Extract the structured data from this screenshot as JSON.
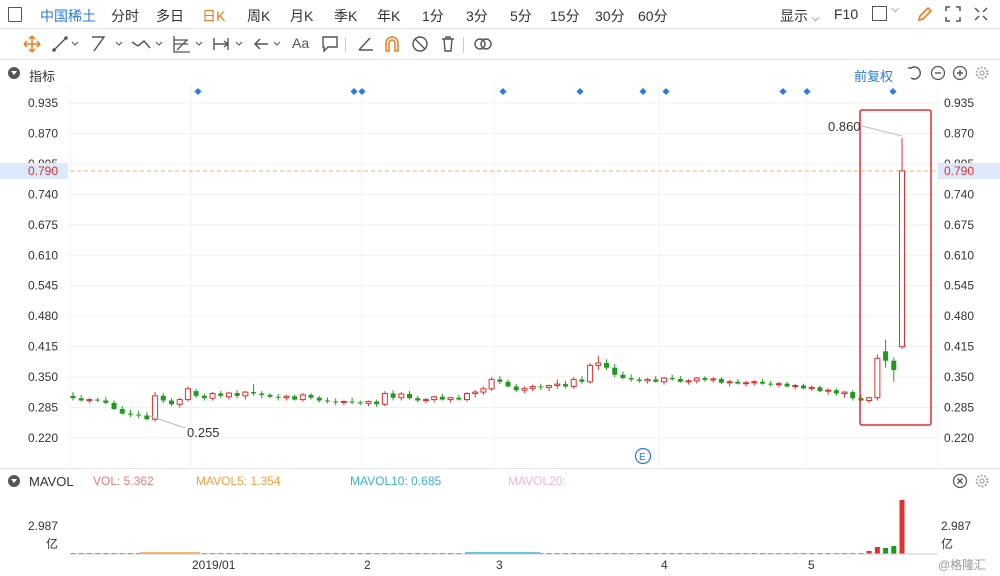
{
  "topbar": {
    "stock_name": "中国稀土",
    "periods": [
      "分时",
      "多日",
      "日K",
      "周K",
      "月K",
      "季K",
      "年K",
      "1分",
      "3分",
      "5分",
      "15分",
      "30分",
      "60分"
    ],
    "active_period": "日K",
    "display_label": "显示",
    "f10_label": "F10"
  },
  "toolbar": {
    "text_tool": "Aa"
  },
  "indicator": {
    "label": "指标",
    "adjust_label": "前复权"
  },
  "price_axis": {
    "ticks": [
      "0.935",
      "0.870",
      "0.805",
      "0.790",
      "0.740",
      "0.675",
      "0.610",
      "0.545",
      "0.480",
      "0.415",
      "0.350",
      "0.285",
      "0.220"
    ],
    "current_price": "0.790",
    "current_color": "#e03030"
  },
  "annotations": {
    "high_label": "0.860",
    "low_label": "0.255",
    "event_marker": "E"
  },
  "x_axis": {
    "labels": [
      "2019/01",
      "2",
      "3",
      "4",
      "5"
    ]
  },
  "volume": {
    "label": "MAVOL",
    "vol": "VOL: 5.362",
    "mavol5": "MAVOL5: 1.354",
    "mavol10": "MAVOL10: 0.685",
    "mavol20": "MAVOL20:",
    "axis_value": "2.987",
    "axis_unit": "亿"
  },
  "colors": {
    "up": "#e03030",
    "down": "#1e9a1e",
    "accent": "#2a7ae2",
    "active": "#f07a15",
    "vol_color": "#e87a7a",
    "mavol5_color": "#f0a040",
    "mavol10_color": "#3cb0d0",
    "mavol20_color": "#e8a0d8"
  },
  "watermark": "@格隆汇",
  "chart_data": {
    "type": "candlestick",
    "ylim": [
      0.22,
      0.935
    ],
    "candles": [
      [
        0.31,
        0.318,
        0.3,
        0.305
      ],
      [
        0.305,
        0.312,
        0.298,
        0.3
      ],
      [
        0.3,
        0.305,
        0.295,
        0.302
      ],
      [
        0.302,
        0.306,
        0.297,
        0.3
      ],
      [
        0.3,
        0.308,
        0.292,
        0.295
      ],
      [
        0.295,
        0.3,
        0.28,
        0.282
      ],
      [
        0.282,
        0.288,
        0.27,
        0.272
      ],
      [
        0.272,
        0.28,
        0.265,
        0.27
      ],
      [
        0.27,
        0.278,
        0.262,
        0.268
      ],
      [
        0.268,
        0.275,
        0.258,
        0.26
      ],
      [
        0.26,
        0.318,
        0.255,
        0.31
      ],
      [
        0.31,
        0.316,
        0.295,
        0.3
      ],
      [
        0.3,
        0.305,
        0.288,
        0.292
      ],
      [
        0.292,
        0.306,
        0.285,
        0.302
      ],
      [
        0.302,
        0.33,
        0.298,
        0.325
      ],
      [
        0.32,
        0.325,
        0.305,
        0.31
      ],
      [
        0.31,
        0.315,
        0.3,
        0.305
      ],
      [
        0.305,
        0.318,
        0.3,
        0.315
      ],
      [
        0.315,
        0.32,
        0.305,
        0.31
      ],
      [
        0.308,
        0.318,
        0.302,
        0.316
      ],
      [
        0.316,
        0.322,
        0.305,
        0.31
      ],
      [
        0.31,
        0.32,
        0.302,
        0.318
      ],
      [
        0.318,
        0.335,
        0.31,
        0.315
      ],
      [
        0.315,
        0.32,
        0.305,
        0.312
      ],
      [
        0.312,
        0.316,
        0.305,
        0.308
      ],
      [
        0.308,
        0.314,
        0.3,
        0.306
      ],
      [
        0.306,
        0.312,
        0.3,
        0.309
      ],
      [
        0.309,
        0.313,
        0.3,
        0.302
      ],
      [
        0.302,
        0.316,
        0.298,
        0.312
      ],
      [
        0.312,
        0.316,
        0.302,
        0.306
      ],
      [
        0.306,
        0.31,
        0.296,
        0.3
      ],
      [
        0.3,
        0.306,
        0.294,
        0.298
      ],
      [
        0.298,
        0.304,
        0.29,
        0.296
      ],
      [
        0.296,
        0.3,
        0.29,
        0.298
      ],
      [
        0.298,
        0.306,
        0.292,
        0.296
      ],
      [
        0.296,
        0.3,
        0.29,
        0.294
      ],
      [
        0.294,
        0.3,
        0.288,
        0.298
      ],
      [
        0.298,
        0.302,
        0.286,
        0.292
      ],
      [
        0.292,
        0.32,
        0.288,
        0.315
      ],
      [
        0.315,
        0.322,
        0.3,
        0.306
      ],
      [
        0.306,
        0.318,
        0.3,
        0.314
      ],
      [
        0.314,
        0.32,
        0.302,
        0.305
      ],
      [
        0.305,
        0.31,
        0.296,
        0.3
      ],
      [
        0.3,
        0.306,
        0.294,
        0.302
      ],
      [
        0.302,
        0.31,
        0.296,
        0.308
      ],
      [
        0.308,
        0.314,
        0.3,
        0.302
      ],
      [
        0.302,
        0.308,
        0.296,
        0.306
      ],
      [
        0.306,
        0.312,
        0.3,
        0.302
      ],
      [
        0.302,
        0.318,
        0.298,
        0.315
      ],
      [
        0.315,
        0.322,
        0.306,
        0.318
      ],
      [
        0.318,
        0.33,
        0.312,
        0.325
      ],
      [
        0.325,
        0.35,
        0.32,
        0.345
      ],
      [
        0.345,
        0.352,
        0.335,
        0.34
      ],
      [
        0.34,
        0.345,
        0.328,
        0.33
      ],
      [
        0.33,
        0.336,
        0.318,
        0.322
      ],
      [
        0.322,
        0.33,
        0.316,
        0.326
      ],
      [
        0.326,
        0.334,
        0.32,
        0.33
      ],
      [
        0.33,
        0.336,
        0.322,
        0.328
      ],
      [
        0.328,
        0.334,
        0.32,
        0.332
      ],
      [
        0.332,
        0.345,
        0.325,
        0.335
      ],
      [
        0.335,
        0.342,
        0.326,
        0.33
      ],
      [
        0.33,
        0.35,
        0.325,
        0.345
      ],
      [
        0.345,
        0.352,
        0.336,
        0.34
      ],
      [
        0.34,
        0.38,
        0.336,
        0.375
      ],
      [
        0.375,
        0.395,
        0.365,
        0.38
      ],
      [
        0.38,
        0.388,
        0.365,
        0.37
      ],
      [
        0.37,
        0.378,
        0.35,
        0.355
      ],
      [
        0.355,
        0.362,
        0.345,
        0.348
      ],
      [
        0.348,
        0.356,
        0.34,
        0.345
      ],
      [
        0.345,
        0.35,
        0.338,
        0.342
      ],
      [
        0.342,
        0.348,
        0.336,
        0.345
      ],
      [
        0.345,
        0.352,
        0.338,
        0.34
      ],
      [
        0.34,
        0.35,
        0.334,
        0.348
      ],
      [
        0.348,
        0.355,
        0.342,
        0.346
      ],
      [
        0.346,
        0.352,
        0.338,
        0.34
      ],
      [
        0.34,
        0.346,
        0.334,
        0.342
      ],
      [
        0.342,
        0.35,
        0.336,
        0.348
      ],
      [
        0.348,
        0.352,
        0.34,
        0.344
      ],
      [
        0.344,
        0.35,
        0.338,
        0.346
      ],
      [
        0.346,
        0.35,
        0.335,
        0.338
      ],
      [
        0.338,
        0.344,
        0.33,
        0.34
      ],
      [
        0.34,
        0.346,
        0.334,
        0.336
      ],
      [
        0.336,
        0.342,
        0.33,
        0.338
      ],
      [
        0.338,
        0.344,
        0.332,
        0.34
      ],
      [
        0.34,
        0.346,
        0.334,
        0.336
      ],
      [
        0.336,
        0.342,
        0.33,
        0.334
      ],
      [
        0.334,
        0.34,
        0.328,
        0.336
      ],
      [
        0.336,
        0.34,
        0.328,
        0.33
      ],
      [
        0.33,
        0.336,
        0.324,
        0.332
      ],
      [
        0.332,
        0.336,
        0.324,
        0.326
      ],
      [
        0.326,
        0.332,
        0.32,
        0.328
      ],
      [
        0.328,
        0.332,
        0.318,
        0.32
      ],
      [
        0.32,
        0.326,
        0.312,
        0.322
      ],
      [
        0.322,
        0.326,
        0.31,
        0.315
      ],
      [
        0.315,
        0.32,
        0.306,
        0.318
      ],
      [
        0.318,
        0.322,
        0.3,
        0.305
      ],
      [
        0.305,
        0.312,
        0.298,
        0.3
      ],
      [
        0.3,
        0.308,
        0.295,
        0.306
      ],
      [
        0.306,
        0.398,
        0.3,
        0.39
      ],
      [
        0.405,
        0.43,
        0.37,
        0.385
      ],
      [
        0.385,
        0.392,
        0.34,
        0.365
      ],
      [
        0.415,
        0.86,
        0.41,
        0.79
      ]
    ]
  }
}
